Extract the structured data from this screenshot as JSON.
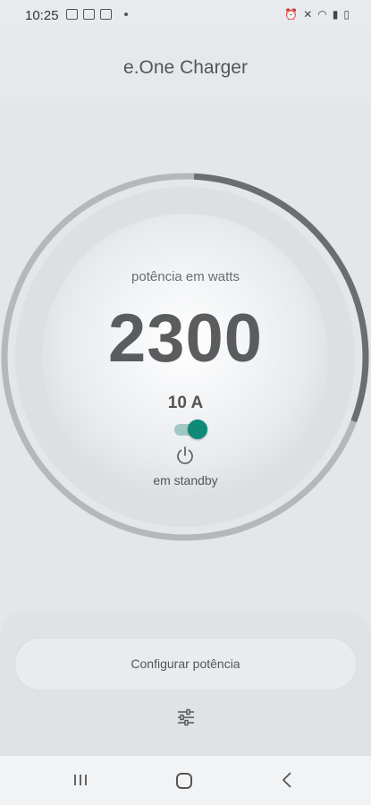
{
  "status_bar": {
    "time": "10:25",
    "left_icons": [
      "gallery-icon",
      "youtube-icon",
      "checkbox-icon"
    ],
    "right_icons": [
      "alarm-icon",
      "mute-icon",
      "wifi-icon",
      "signal-icon",
      "battery-icon"
    ]
  },
  "app": {
    "title": "e.One Charger"
  },
  "gauge": {
    "label": "potência em watts",
    "value": "2300",
    "amperage": "10 A",
    "toggle_on": true,
    "status": "em standby",
    "level": 0.3,
    "colors": {
      "track": "#b5b8bb",
      "progress": "#6b6d6f",
      "accent": "#0f8a78"
    }
  },
  "bottom": {
    "configure_label": "Configurar potência",
    "settings_icon": "sliders-icon"
  },
  "navbar": {
    "recent": "recent-apps-icon",
    "home": "home-icon",
    "back": "back-icon"
  }
}
